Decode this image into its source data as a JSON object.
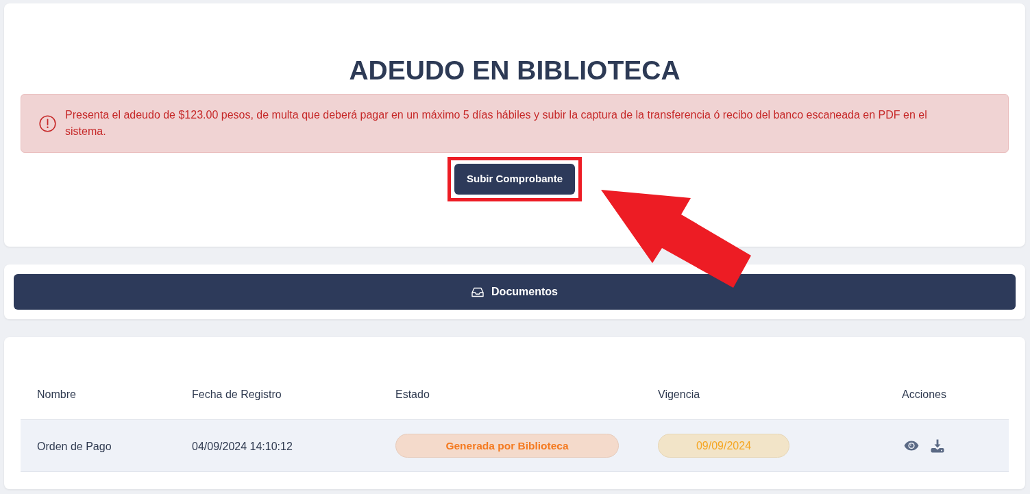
{
  "header": {
    "title": "ADEUDO EN BIBLIOTECA"
  },
  "alert": {
    "message": "Presenta el adeudo de $123.00 pesos, de multa que deberá pagar en un máximo 5 días hábiles y subir la captura de la transferencia ó recibo del banco escaneada en PDF en el sistema."
  },
  "upload_button": {
    "label": "Subir Comprobante"
  },
  "annotations": {
    "frame_around_button": true,
    "pointer_arrow": true
  },
  "documents_bar": {
    "label": "Documentos"
  },
  "table": {
    "columns": [
      "Nombre",
      "Fecha de Registro",
      "Estado",
      "Vigencia",
      "Acciones"
    ],
    "rows": [
      {
        "nombre": "Orden de Pago",
        "fecha": "04/09/2024 14:10:12",
        "estado": "Generada por Biblioteca",
        "vigencia": "09/09/2024",
        "actions": [
          {
            "kind": "view"
          },
          {
            "kind": "download"
          }
        ]
      }
    ]
  }
}
